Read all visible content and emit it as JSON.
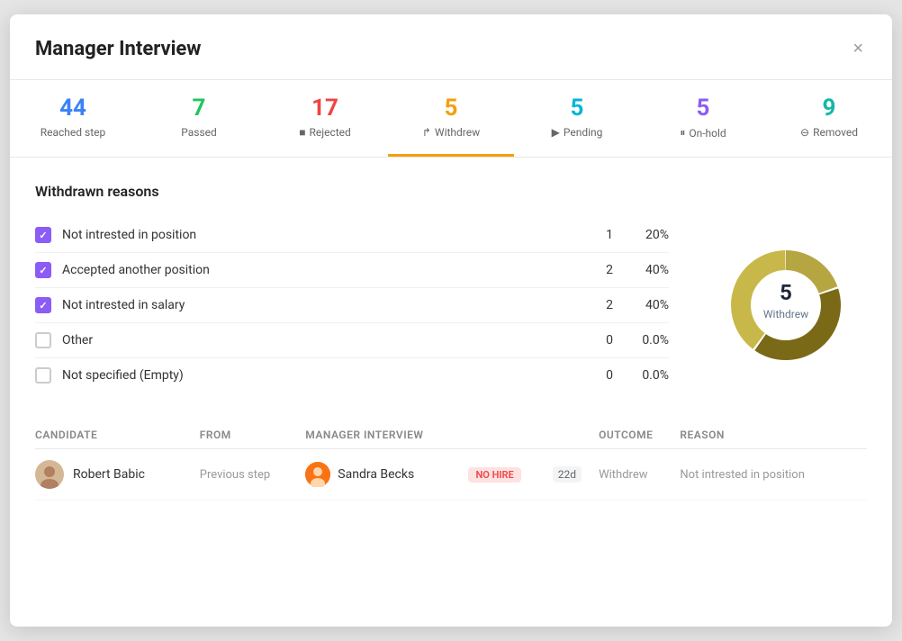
{
  "modal": {
    "title": "Manager Interview",
    "close_label": "×"
  },
  "tabs": [
    {
      "id": "reached",
      "number": "44",
      "label": "Reached step",
      "color": "blue",
      "active": false,
      "icon": ""
    },
    {
      "id": "passed",
      "number": "7",
      "label": "Passed",
      "color": "green",
      "active": false,
      "icon": ""
    },
    {
      "id": "rejected",
      "number": "17",
      "label": "Rejected",
      "color": "red",
      "active": false,
      "icon": "■"
    },
    {
      "id": "withdrew",
      "number": "5",
      "label": "Withdrew",
      "color": "orange",
      "active": true,
      "icon": "↱"
    },
    {
      "id": "pending",
      "number": "5",
      "label": "Pending",
      "color": "cyan",
      "active": false,
      "icon": "▶"
    },
    {
      "id": "onhold",
      "number": "5",
      "label": "On-hold",
      "color": "purple",
      "active": false,
      "icon": "⏸"
    },
    {
      "id": "removed",
      "number": "9",
      "label": "Removed",
      "color": "teal",
      "active": false,
      "icon": "⊖"
    }
  ],
  "section_title": "Withdrawn reasons",
  "reasons": [
    {
      "label": "Not intrested in position",
      "count": 1,
      "pct": "20%",
      "checked": true
    },
    {
      "label": "Accepted another position",
      "count": 2,
      "pct": "40%",
      "checked": true
    },
    {
      "label": "Not intrested in salary",
      "count": 2,
      "pct": "40%",
      "checked": true
    },
    {
      "label": "Other",
      "count": 0,
      "pct": "0.0%",
      "checked": false
    },
    {
      "label": "Not specified (Empty)",
      "count": 0,
      "pct": "0.0%",
      "checked": false
    }
  ],
  "donut": {
    "center_number": "5",
    "center_label": "Withdrew",
    "segments": [
      {
        "label": "Not intrested in position",
        "value": 1,
        "color": "#b5a642"
      },
      {
        "label": "Accepted another position",
        "value": 2,
        "color": "#8b7a20"
      },
      {
        "label": "Not intrested in salary",
        "value": 2,
        "color": "#d4c14a"
      }
    ]
  },
  "candidates_table": {
    "columns": [
      "Candidate",
      "From",
      "Manager Interview",
      "",
      "",
      "Outcome",
      "Reason"
    ],
    "rows": [
      {
        "candidate_name": "Robert Babic",
        "from": "Previous step",
        "interviewer_name": "Sandra Becks",
        "badge": "NO HIRE",
        "days": "22d",
        "outcome": "Withdrew",
        "reason": "Not intrested in position"
      }
    ]
  }
}
